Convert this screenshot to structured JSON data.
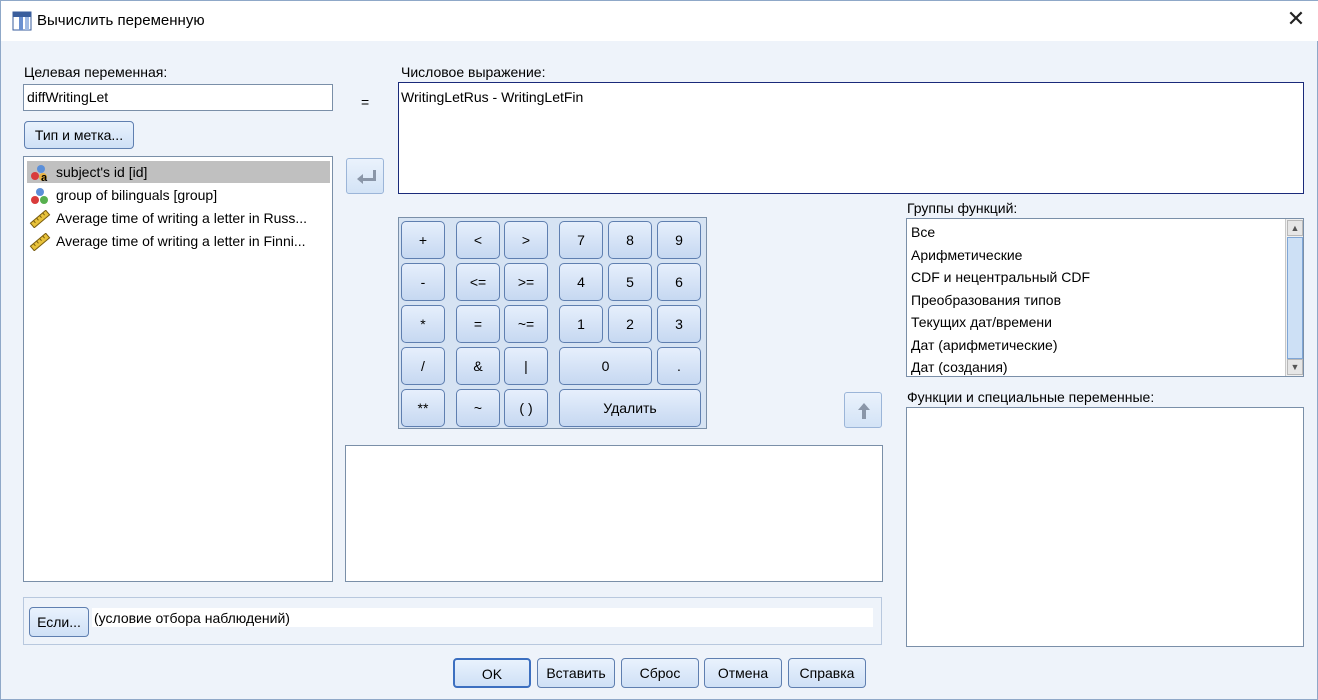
{
  "window": {
    "title": "Вычислить переменную",
    "close_glyph": "✕"
  },
  "target": {
    "label": "Целевая переменная:",
    "value": "diffWritingLet",
    "type_button": "Тип и метка..."
  },
  "equals_sign": "=",
  "expression": {
    "label": "Числовое выражение:",
    "value": "WritingLetRus - WritingLetFin"
  },
  "variables": [
    {
      "label": "subject's id [id]",
      "icon": "nominal-string-icon",
      "selected": true
    },
    {
      "label": "group of bilinguals [group]",
      "icon": "nominal-icon",
      "selected": false
    },
    {
      "label": "Average time of writing a letter in Russ...",
      "icon": "scale-ruler-icon",
      "selected": false
    },
    {
      "label": "Average time of writing a letter in Finni...",
      "icon": "scale-ruler-icon",
      "selected": false
    }
  ],
  "keypad": {
    "plus": "+",
    "lt": "<",
    "gt": ">",
    "k7": "7",
    "k8": "8",
    "k9": "9",
    "minus": "-",
    "le": "<=",
    "ge": ">=",
    "k4": "4",
    "k5": "5",
    "k6": "6",
    "mult": "*",
    "eq": "=",
    "ne": "~=",
    "k1": "1",
    "k2": "2",
    "k3": "3",
    "div": "/",
    "and": "&",
    "or": "|",
    "k0": "0",
    "dot": ".",
    "pow": "**",
    "not": "~",
    "paren": "( )",
    "delete": "Удалить"
  },
  "function_groups": {
    "label": "Группы функций:",
    "items": [
      "Все",
      "Арифметические",
      "CDF и нецентральный CDF",
      "Преобразования типов",
      "Текущих дат/времени",
      "Дат (арифметические)",
      "Дат (создания)"
    ]
  },
  "functions": {
    "label": "Функции и специальные переменные:"
  },
  "if_panel": {
    "button": "Если...",
    "condition": "(условие отбора наблюдений)"
  },
  "footer": {
    "ok": "OK",
    "paste": "Вставить",
    "reset": "Сброс",
    "cancel": "Отмена",
    "help": "Справка"
  },
  "colors": {
    "dialog_bg": "#eef3fa",
    "button_border": "#5f7fb0",
    "selection_bg": "#c0c0c0",
    "expression_border": "#1a2a7a"
  }
}
